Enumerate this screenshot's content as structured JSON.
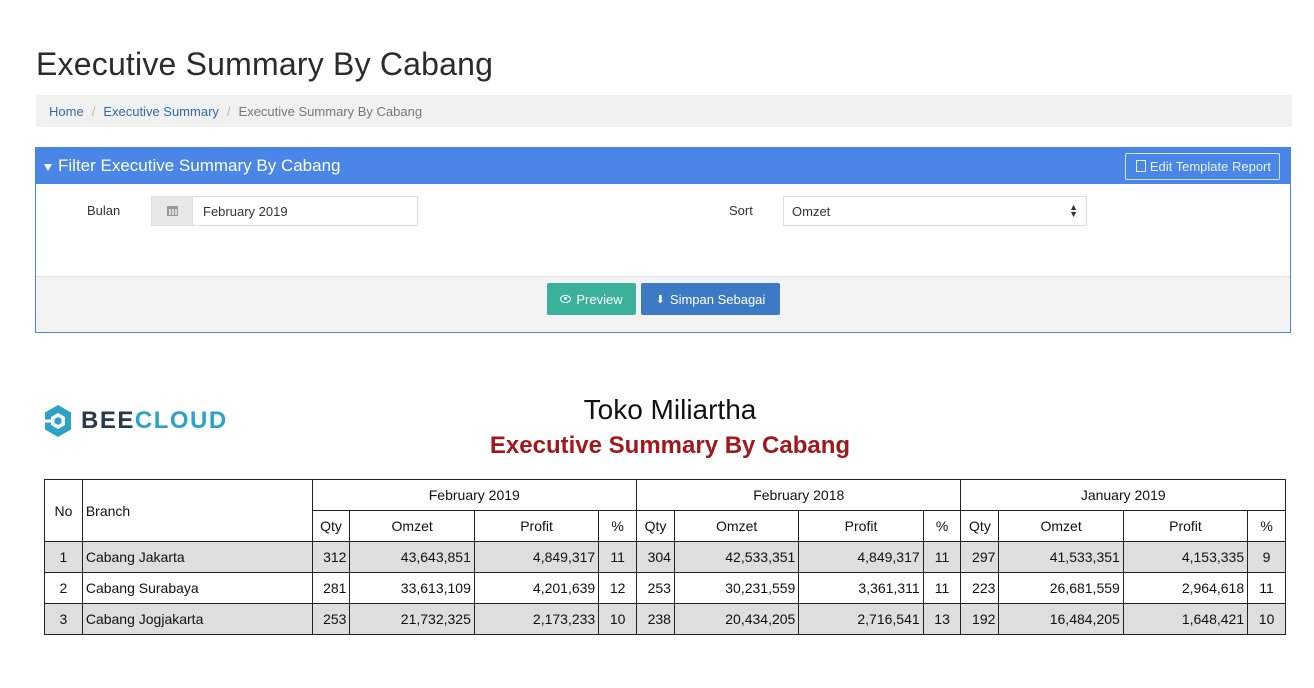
{
  "page": {
    "title": "Executive Summary By Cabang"
  },
  "breadcrumb": [
    "Home",
    "Executive Summary",
    "Executive Summary By Cabang"
  ],
  "filter": {
    "title": "Filter Executive Summary By Cabang",
    "edit_template_label": "Edit Template Report",
    "month_label": "Bulan",
    "month_value": "February 2019",
    "sort_label": "Sort",
    "sort_value": "Omzet",
    "preview_label": "Preview",
    "save_label": "Simpan Sebagai"
  },
  "colors": {
    "primary": "#4a86e8",
    "preview": "#3bb09a",
    "save": "#3d7ac6",
    "subtitle": "#a3171b"
  },
  "logo": {
    "part1": "BEE",
    "part2": "CLOUD"
  },
  "report": {
    "company": "Toko Miliartha",
    "title": "Executive Summary By Cabang",
    "headers": {
      "no": "No",
      "branch": "Branch",
      "qty": "Qty",
      "omzet": "Omzet",
      "profit": "Profit",
      "pct": "%"
    },
    "periods": [
      "February 2019",
      "February 2018",
      "January 2019"
    ],
    "rows": [
      {
        "no": "1",
        "branch": "Cabang Jakarta",
        "p1": [
          "312",
          "43,643,851",
          "4,849,317",
          "11"
        ],
        "p2": [
          "304",
          "42,533,351",
          "4,849,317",
          "11"
        ],
        "p3": [
          "297",
          "41,533,351",
          "4,153,335",
          "9"
        ]
      },
      {
        "no": "2",
        "branch": "Cabang Surabaya",
        "p1": [
          "281",
          "33,613,109",
          "4,201,639",
          "12"
        ],
        "p2": [
          "253",
          "30,231,559",
          "3,361,311",
          "11"
        ],
        "p3": [
          "223",
          "26,681,559",
          "2,964,618",
          "11"
        ]
      },
      {
        "no": "3",
        "branch": "Cabang Jogjakarta",
        "p1": [
          "253",
          "21,732,325",
          "2,173,233",
          "10"
        ],
        "p2": [
          "238",
          "20,434,205",
          "2,716,541",
          "13"
        ],
        "p3": [
          "192",
          "16,484,205",
          "1,648,421",
          "10"
        ]
      }
    ]
  }
}
